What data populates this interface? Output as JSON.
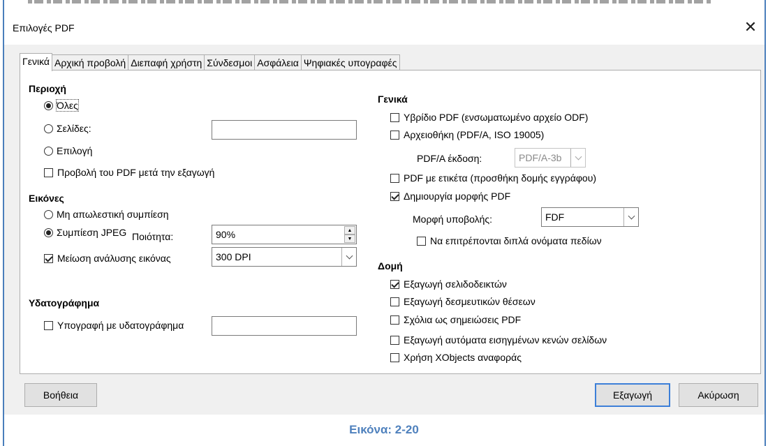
{
  "dialog": {
    "title": "Επιλογές PDF",
    "close_symbol": "✕",
    "tabs": [
      "Γενικά",
      "Αρχική προβολή",
      "Διεπαφή χρήστη",
      "Σύνδεσμοι",
      "Ασφάλεια",
      "Ψηφιακές υπογραφές"
    ],
    "active_tab": "Γενικά"
  },
  "range": {
    "title": "Περιοχή",
    "all": "Όλες",
    "pages": "Σελίδες:",
    "pages_value": "",
    "selection": "Επιλογή",
    "selected": "Όλες",
    "view_after": "Προβολή του PDF μετά την εξαγωγή",
    "view_after_checked": false
  },
  "images": {
    "title": "Εικόνες",
    "lossless": "Μη απωλεστική συμπίεση",
    "jpeg": "Συμπίεση JPEG",
    "selected": "Συμπίεση JPEG",
    "quality_label": "Ποιότητα:",
    "quality_value": "90%",
    "reduce_label": "Μείωση ανάλυσης εικόνας",
    "reduce_checked": true,
    "resolution_value": "300 DPI"
  },
  "watermark": {
    "title": "Υδατογράφημα",
    "sign_label": "Υπογραφή με υδατογράφημα",
    "sign_checked": false,
    "text_value": ""
  },
  "general": {
    "title": "Γενικά",
    "hybrid": "Υβρίδιο PDF (ενσωματωμένο αρχείο ODF)",
    "hybrid_checked": false,
    "archive": "Αρχειοθήκη (PDF/A, ISO 19005)",
    "archive_checked": false,
    "pdfa_label": "PDF/A έκδοση:",
    "pdfa_value": "PDF/A-3b",
    "tagged": "PDF με ετικέτα (προσθήκη δομής εγγράφου)",
    "tagged_checked": false,
    "form": "Δημιουργία μορφής PDF",
    "form_checked": true,
    "submit_label": "Μορφή υποβολής:",
    "submit_value": "FDF",
    "dup_names": "Να επιτρέπονται διπλά ονόματα πεδίων",
    "dup_names_checked": false
  },
  "structure": {
    "title": "Δομή",
    "bookmarks": "Εξαγωγή σελιδοδεικτών",
    "bookmarks_checked": true,
    "placeholders": "Εξαγωγή δεσμευτικών θέσεων",
    "placeholders_checked": false,
    "comments": "Σχόλια ως σημειώσεις PDF",
    "comments_checked": false,
    "blank_pages": "Εξαγωγή αυτόματα εισηγμένων κενών σελίδων",
    "blank_pages_checked": false,
    "xobjects": "Χρήση XObjects αναφοράς",
    "xobjects_checked": false
  },
  "buttons": {
    "help": "Βοήθεια",
    "export": "Εξαγωγή",
    "cancel": "Ακύρωση"
  },
  "caption": "Εικόνα: 2-20"
}
